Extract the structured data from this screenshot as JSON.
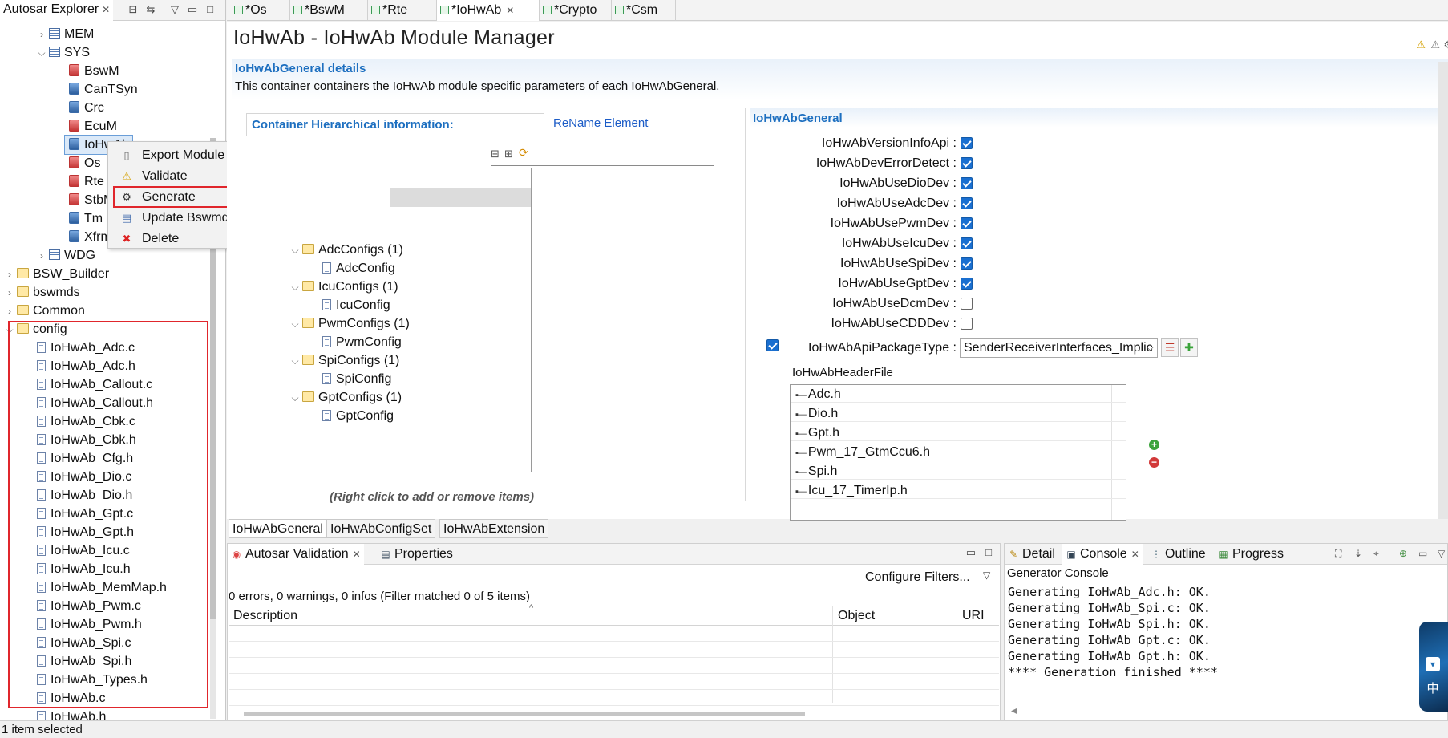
{
  "explorer": {
    "title": "Autosar Explorer",
    "tree": [
      {
        "label": "MEM",
        "kind": "list",
        "indent": 1,
        "twisty": ">"
      },
      {
        "label": "SYS",
        "kind": "list",
        "indent": 1,
        "twisty": "v"
      },
      {
        "label": "BswM",
        "kind": "module-red",
        "indent": 2
      },
      {
        "label": "CanTSyn",
        "kind": "module",
        "indent": 2
      },
      {
        "label": "Crc",
        "kind": "module",
        "indent": 2
      },
      {
        "label": "EcuM",
        "kind": "module-red",
        "indent": 2
      },
      {
        "label": "IoHwAb",
        "kind": "module",
        "indent": 2,
        "selected": true
      },
      {
        "label": "Os",
        "kind": "module-red",
        "indent": 2
      },
      {
        "label": "Rte",
        "kind": "rte",
        "indent": 2
      },
      {
        "label": "StbM",
        "kind": "module-red",
        "indent": 2
      },
      {
        "label": "Tm",
        "kind": "module",
        "indent": 2
      },
      {
        "label": "Xfrm",
        "kind": "module",
        "indent": 2
      },
      {
        "label": "WDG",
        "kind": "list",
        "indent": 1,
        "twisty": ">"
      },
      {
        "label": "BSW_Builder",
        "kind": "folder",
        "indent": 0,
        "twisty": ">"
      },
      {
        "label": "bswmds",
        "kind": "folder",
        "indent": 0,
        "twisty": ">"
      },
      {
        "label": "Common",
        "kind": "folder",
        "indent": 0,
        "twisty": ">"
      },
      {
        "label": "config",
        "kind": "folder",
        "indent": 0,
        "twisty": "v"
      }
    ],
    "files": [
      "IoHwAb_Adc.c",
      "IoHwAb_Adc.h",
      "IoHwAb_Callout.c",
      "IoHwAb_Callout.h",
      "IoHwAb_Cbk.c",
      "IoHwAb_Cbk.h",
      "IoHwAb_Cfg.h",
      "IoHwAb_Dio.c",
      "IoHwAb_Dio.h",
      "IoHwAb_Gpt.c",
      "IoHwAb_Gpt.h",
      "IoHwAb_Icu.c",
      "IoHwAb_Icu.h",
      "IoHwAb_MemMap.h",
      "IoHwAb_Pwm.c",
      "IoHwAb_Pwm.h",
      "IoHwAb_Spi.c",
      "IoHwAb_Spi.h",
      "IoHwAb_Types.h",
      "IoHwAb.c",
      "IoHwAb.h"
    ],
    "status": "1 item selected"
  },
  "context_menu": {
    "items": [
      {
        "label": "Export Module File",
        "icon": "export-file-icon"
      },
      {
        "label": "Validate",
        "icon": "warning-icon"
      },
      {
        "label": "Generate",
        "icon": "generate-gear-icon",
        "highlighted": true
      },
      {
        "label": "Update Bswmd",
        "icon": "update-doc-icon"
      },
      {
        "label": "Delete",
        "icon": "delete-x-icon"
      }
    ]
  },
  "editor_tabs": [
    {
      "label": "*Os"
    },
    {
      "label": "*BswM"
    },
    {
      "label": "*Rte"
    },
    {
      "label": "*IoHwAb",
      "active": true
    },
    {
      "label": "*Crypto"
    },
    {
      "label": "*Csm"
    }
  ],
  "editor": {
    "title": "IoHwAb - IoHwAb Module Manager",
    "section_title": "IoHwAbGeneral details",
    "section_desc": "This container containers the IoHwAb module specific parameters of each IoHwAbGeneral.",
    "hier_label": "Container Hierarchical information:",
    "rename_link": "ReName Element",
    "hint": "(Right click to add or remove items)",
    "config_tree": [
      {
        "label": "AdcConfigs (1)",
        "child": "AdcConfig"
      },
      {
        "label": "IcuConfigs (1)",
        "child": "IcuConfig"
      },
      {
        "label": "PwmConfigs (1)",
        "child": "PwmConfig"
      },
      {
        "label": "SpiConfigs (1)",
        "child": "SpiConfig"
      },
      {
        "label": "GptConfigs (1)",
        "child": "GptConfig"
      }
    ],
    "general_title": "IoHwAbGeneral",
    "params": [
      {
        "label": "IoHwAbVersionInfoApi :",
        "checked": true
      },
      {
        "label": "IoHwAbDevErrorDetect :",
        "checked": true
      },
      {
        "label": "IoHwAbUseDioDev :",
        "checked": true
      },
      {
        "label": "IoHwAbUseAdcDev :",
        "checked": true
      },
      {
        "label": "IoHwAbUsePwmDev :",
        "checked": true
      },
      {
        "label": "IoHwAbUseIcuDev :",
        "checked": true
      },
      {
        "label": "IoHwAbUseSpiDev :",
        "checked": true
      },
      {
        "label": "IoHwAbUseGptDev :",
        "checked": true
      },
      {
        "label": "IoHwAbUseDcmDev :",
        "checked": false
      },
      {
        "label": "IoHwAbUseCDDDev :",
        "checked": false
      }
    ],
    "api_package": {
      "label": "IoHwAbApiPackageType :",
      "value": "SenderReceiverInterfaces_Implic",
      "enabled": true
    },
    "header_file_label": "IoHwAbHeaderFile",
    "header_files": [
      "Adc.h",
      "Dio.h",
      "Gpt.h",
      "Pwm_17_GtmCcu6.h",
      "Spi.h",
      "Icu_17_TimerIp.h"
    ],
    "bottom_tabs": [
      {
        "label": "IoHwAbGeneral",
        "active": true
      },
      {
        "label": "IoHwAbConfigSet"
      },
      {
        "label": "IoHwAbExtension"
      }
    ]
  },
  "validation": {
    "tabs": [
      {
        "label": "Autosar Validation",
        "active": true
      },
      {
        "label": "Properties"
      }
    ],
    "filter_button": "Configure Filters...",
    "summary": "0 errors, 0 warnings, 0 infos (Filter matched 0 of 5 items)",
    "columns": [
      "Description",
      "Object",
      "URI"
    ]
  },
  "console": {
    "tabs": [
      {
        "label": "Detail"
      },
      {
        "label": "Console",
        "active": true
      },
      {
        "label": "Outline"
      },
      {
        "label": "Progress"
      }
    ],
    "title": "Generator Console",
    "lines": [
      "Generating IoHwAb_Adc.h: OK.",
      "Generating IoHwAb_Spi.c: OK.",
      "Generating IoHwAb_Spi.h: OK.",
      "Generating IoHwAb_Gpt.c: OK.",
      "Generating IoHwAb_Gpt.h: OK.",
      "**** Generation finished ****"
    ]
  },
  "side_widget": {
    "glyph_top": "中"
  },
  "colors": {
    "accent_blue": "#1d6fc0",
    "highlight_red": "#e0262c",
    "checkbox_blue": "#1a6fd0"
  }
}
